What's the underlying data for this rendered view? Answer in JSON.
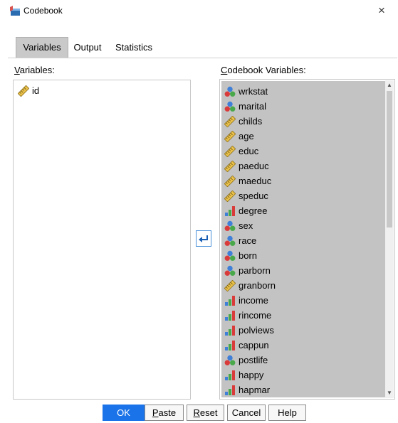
{
  "window": {
    "title": "Codebook",
    "close_glyph": "×"
  },
  "tabs": [
    {
      "label": "Variables",
      "active": true
    },
    {
      "label": "Output",
      "active": false
    },
    {
      "label": "Statistics",
      "active": false
    }
  ],
  "left_panel": {
    "label_first": "V",
    "label_rest": "ariables:",
    "items": [
      {
        "name": "id",
        "icon": "scale-ruler-icon"
      }
    ]
  },
  "right_panel": {
    "label_first": "C",
    "label_rest": "odebook Variables:",
    "items": [
      {
        "name": "wrkstat",
        "icon": "nominal-icon"
      },
      {
        "name": "marital",
        "icon": "nominal-icon"
      },
      {
        "name": "childs",
        "icon": "scale-ruler-icon"
      },
      {
        "name": "age",
        "icon": "scale-ruler-icon"
      },
      {
        "name": "educ",
        "icon": "scale-ruler-icon"
      },
      {
        "name": "paeduc",
        "icon": "scale-ruler-icon"
      },
      {
        "name": "maeduc",
        "icon": "scale-ruler-icon"
      },
      {
        "name": "speduc",
        "icon": "scale-ruler-icon"
      },
      {
        "name": "degree",
        "icon": "ordinal-icon"
      },
      {
        "name": "sex",
        "icon": "nominal-icon"
      },
      {
        "name": "race",
        "icon": "nominal-icon"
      },
      {
        "name": "born",
        "icon": "nominal-icon"
      },
      {
        "name": "parborn",
        "icon": "nominal-icon"
      },
      {
        "name": "granborn",
        "icon": "scale-ruler-icon"
      },
      {
        "name": "income",
        "icon": "ordinal-icon"
      },
      {
        "name": "rincome",
        "icon": "ordinal-icon"
      },
      {
        "name": "polviews",
        "icon": "ordinal-icon"
      },
      {
        "name": "cappun",
        "icon": "ordinal-icon"
      },
      {
        "name": "postlife",
        "icon": "nominal-icon"
      },
      {
        "name": "happy",
        "icon": "ordinal-icon"
      },
      {
        "name": "hapmar",
        "icon": "ordinal-icon"
      }
    ]
  },
  "move_button_icon": "arrow-left-icon",
  "buttons": [
    {
      "first": "",
      "u": "",
      "rest": "OK",
      "primary": true
    },
    {
      "first": "",
      "u": "P",
      "rest": "aste",
      "primary": false
    },
    {
      "first": "",
      "u": "R",
      "rest": "eset",
      "primary": false
    },
    {
      "first": "",
      "u": "",
      "rest": "Cancel",
      "primary": false
    },
    {
      "first": "",
      "u": "",
      "rest": "Help",
      "primary": false
    }
  ],
  "colors": {
    "accent": "#1a73e8",
    "selection": "#c3c3c3"
  }
}
